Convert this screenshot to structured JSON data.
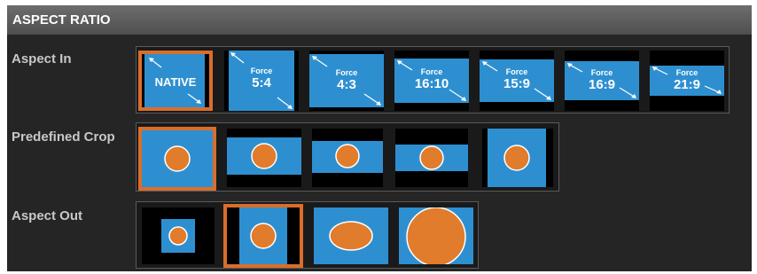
{
  "header": {
    "title": "ASPECT RATIO"
  },
  "rows": {
    "aspect_in": {
      "label": "Aspect In",
      "tiles": [
        {
          "name": "native",
          "label": "NATIVE",
          "selected": true
        },
        {
          "name": "force-5-4",
          "force_label": "Force",
          "ratio": "5:4",
          "selected": false
        },
        {
          "name": "force-4-3",
          "force_label": "Force",
          "ratio": "4:3",
          "selected": false
        },
        {
          "name": "force-16-10",
          "force_label": "Force",
          "ratio": "16:10",
          "selected": false
        },
        {
          "name": "force-15-9",
          "force_label": "Force",
          "ratio": "15:9",
          "selected": false
        },
        {
          "name": "force-16-9",
          "force_label": "Force",
          "ratio": "16:9",
          "selected": false
        },
        {
          "name": "force-21-9",
          "force_label": "Force",
          "ratio": "21:9",
          "selected": false
        }
      ]
    },
    "predefined_crop": {
      "label": "Predefined Crop",
      "tiles": [
        {
          "name": "crop-full",
          "selected": true
        },
        {
          "name": "crop-wide",
          "selected": false
        },
        {
          "name": "crop-medium",
          "selected": false
        },
        {
          "name": "crop-letterbox",
          "selected": false
        },
        {
          "name": "crop-pillarbox",
          "selected": false
        }
      ]
    },
    "aspect_out": {
      "label": "Aspect Out",
      "tiles": [
        {
          "name": "out-small",
          "selected": false
        },
        {
          "name": "out-pillarbox",
          "selected": true
        },
        {
          "name": "out-stretch",
          "selected": false
        },
        {
          "name": "out-fill",
          "selected": false
        }
      ]
    }
  },
  "colors": {
    "accent": "#d96e2a",
    "screen_blue": "#2e8fd0",
    "circle_orange": "#e07c2c"
  }
}
